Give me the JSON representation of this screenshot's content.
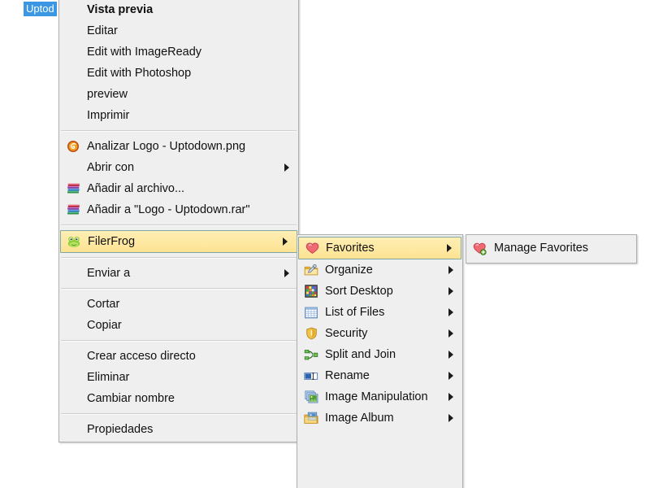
{
  "desktop": {
    "selected_file_label": "Uptod"
  },
  "colors": {
    "menu_background": "#efefef",
    "menu_border": "#aeaeae",
    "highlight_fill": "#fde393",
    "highlight_border": "#7fa8a0",
    "selection_blue": "#3b97e3",
    "text": "#101010",
    "page_background": "#ffffff"
  },
  "file_menu": {
    "name": "file-context-menu",
    "items": [
      {
        "label": "Vista previa",
        "icon": "",
        "bold": true,
        "submenu": false,
        "separator_after": false
      },
      {
        "label": "Editar",
        "icon": "",
        "bold": false,
        "submenu": false,
        "separator_after": false
      },
      {
        "label": "Edit with ImageReady",
        "icon": "",
        "bold": false,
        "submenu": false,
        "separator_after": false
      },
      {
        "label": "Edit with Photoshop",
        "icon": "",
        "bold": false,
        "submenu": false,
        "separator_after": false
      },
      {
        "label": "preview",
        "icon": "",
        "bold": false,
        "submenu": false,
        "separator_after": false
      },
      {
        "label": "Imprimir",
        "icon": "",
        "bold": false,
        "submenu": false,
        "separator_after": true
      },
      {
        "label": "Analizar Logo - Uptodown.png",
        "icon": "antivirus-shield-icon",
        "bold": false,
        "submenu": false,
        "separator_after": false
      },
      {
        "label": "Abrir con",
        "icon": "",
        "bold": false,
        "submenu": true,
        "separator_after": false
      },
      {
        "label": "Añadir al archivo...",
        "icon": "winrar-books-icon",
        "bold": false,
        "submenu": false,
        "separator_after": false
      },
      {
        "label": "Añadir a \"Logo - Uptodown.rar\"",
        "icon": "winrar-books-icon",
        "bold": false,
        "submenu": false,
        "separator_after": true
      },
      {
        "label": "FilerFrog",
        "icon": "frog-icon",
        "bold": false,
        "submenu": true,
        "separator_after": true,
        "highlighted": true
      },
      {
        "label": "Enviar a",
        "icon": "",
        "bold": false,
        "submenu": true,
        "separator_after": true
      },
      {
        "label": "Cortar",
        "icon": "",
        "bold": false,
        "submenu": false,
        "separator_after": false
      },
      {
        "label": "Copiar",
        "icon": "",
        "bold": false,
        "submenu": false,
        "separator_after": true
      },
      {
        "label": "Crear acceso directo",
        "icon": "",
        "bold": false,
        "submenu": false,
        "separator_after": false
      },
      {
        "label": "Eliminar",
        "icon": "",
        "bold": false,
        "submenu": false,
        "separator_after": false
      },
      {
        "label": "Cambiar nombre",
        "icon": "",
        "bold": false,
        "submenu": false,
        "separator_after": true
      },
      {
        "label": "Propiedades",
        "icon": "",
        "bold": false,
        "submenu": false,
        "separator_after": false
      }
    ]
  },
  "filerfrog_menu": {
    "name": "filerfrog-submenu",
    "items": [
      {
        "label": "Favorites",
        "icon": "heart-icon",
        "submenu": true,
        "highlighted": true
      },
      {
        "label": "Organize",
        "icon": "folder-pencil-icon",
        "submenu": true,
        "highlighted": false
      },
      {
        "label": "Sort Desktop",
        "icon": "color-grid-icon",
        "submenu": true,
        "highlighted": false
      },
      {
        "label": "List of Files",
        "icon": "table-list-icon",
        "submenu": true,
        "highlighted": false
      },
      {
        "label": "Security",
        "icon": "shield-icon",
        "submenu": true,
        "highlighted": false
      },
      {
        "label": "Split and Join",
        "icon": "split-join-icon",
        "submenu": true,
        "highlighted": false
      },
      {
        "label": "Rename",
        "icon": "rename-textbox-icon",
        "submenu": true,
        "highlighted": false
      },
      {
        "label": "Image Manipulation",
        "icon": "image-stack-icon",
        "submenu": true,
        "highlighted": false
      },
      {
        "label": "Image Album",
        "icon": "image-album-folder-icon",
        "submenu": true,
        "highlighted": false
      }
    ]
  },
  "favorites_menu": {
    "name": "favorites-submenu",
    "items": [
      {
        "label": "Manage Favorites",
        "icon": "heart-plus-icon",
        "submenu": false,
        "highlighted": false
      }
    ]
  }
}
